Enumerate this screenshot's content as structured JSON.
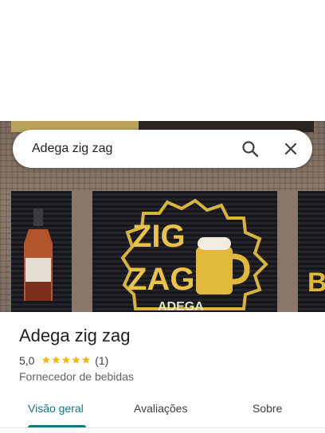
{
  "search": {
    "query": "Adega zig zag",
    "search_icon": "search-icon",
    "close_icon": "close-icon"
  },
  "photo": {
    "description_icon": "storefront-photo",
    "art_text_top": "ZIG",
    "art_text_bottom": "ZAG",
    "art_sub": "ADEGA"
  },
  "place": {
    "title": "Adega zig zag",
    "rating": "5,0",
    "stars": "★★★★★",
    "review_count": "(1)",
    "category": "Fornecedor de bebidas"
  },
  "tabs": [
    {
      "label": "Visão geral",
      "active": true
    },
    {
      "label": "Avaliações",
      "active": false
    },
    {
      "label": "Sobre",
      "active": false
    }
  ],
  "colors": {
    "accent": "#0b7b80",
    "star": "#f5b400",
    "text_primary": "#202124",
    "text_secondary": "#5f6368"
  }
}
